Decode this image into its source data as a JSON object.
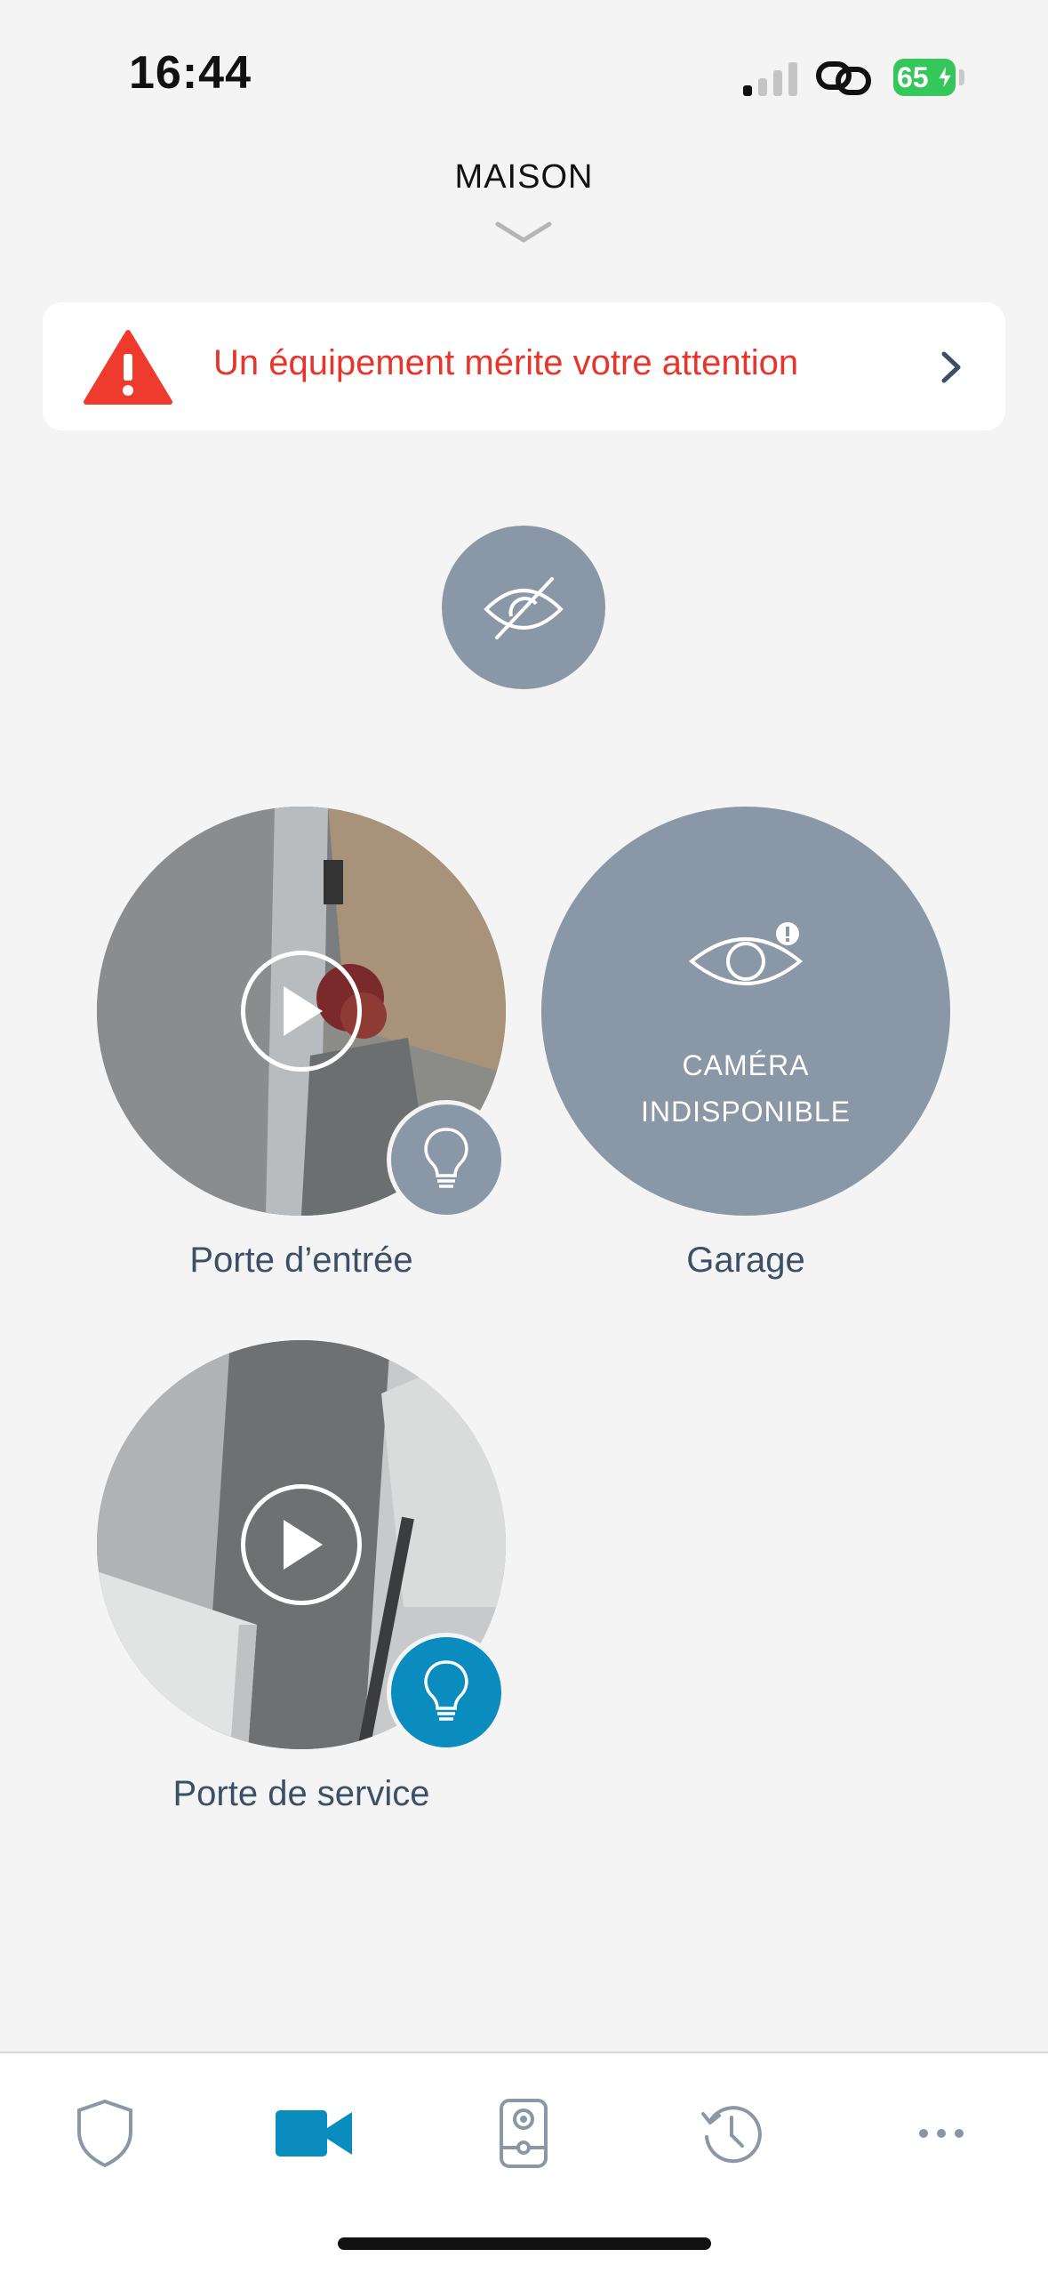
{
  "status_bar": {
    "time": "16:44",
    "battery_level": "65",
    "icons": [
      "signal-icon",
      "link-icon",
      "battery-icon"
    ]
  },
  "header": {
    "title": "MAISON"
  },
  "alert": {
    "message": "Un équipement mérite votre attention",
    "color": "#e8352b"
  },
  "cameras": [
    {
      "name": "Porte d’entrée",
      "status": "live",
      "light_on": false
    },
    {
      "name": "Garage",
      "status": "unavailable",
      "status_text_1": "CAMÉRA",
      "status_text_2": "INDISPONIBLE"
    },
    {
      "name": "Porte de service",
      "status": "live",
      "light_on": true
    }
  ],
  "tabbar": {
    "tabs": [
      {
        "icon": "shield-icon",
        "active": false
      },
      {
        "icon": "video-camera-icon",
        "active": true
      },
      {
        "icon": "doorbell-icon",
        "active": false
      },
      {
        "icon": "history-icon",
        "active": false
      },
      {
        "icon": "more-icon",
        "active": false
      }
    ],
    "active_color": "#0a8cbf"
  }
}
